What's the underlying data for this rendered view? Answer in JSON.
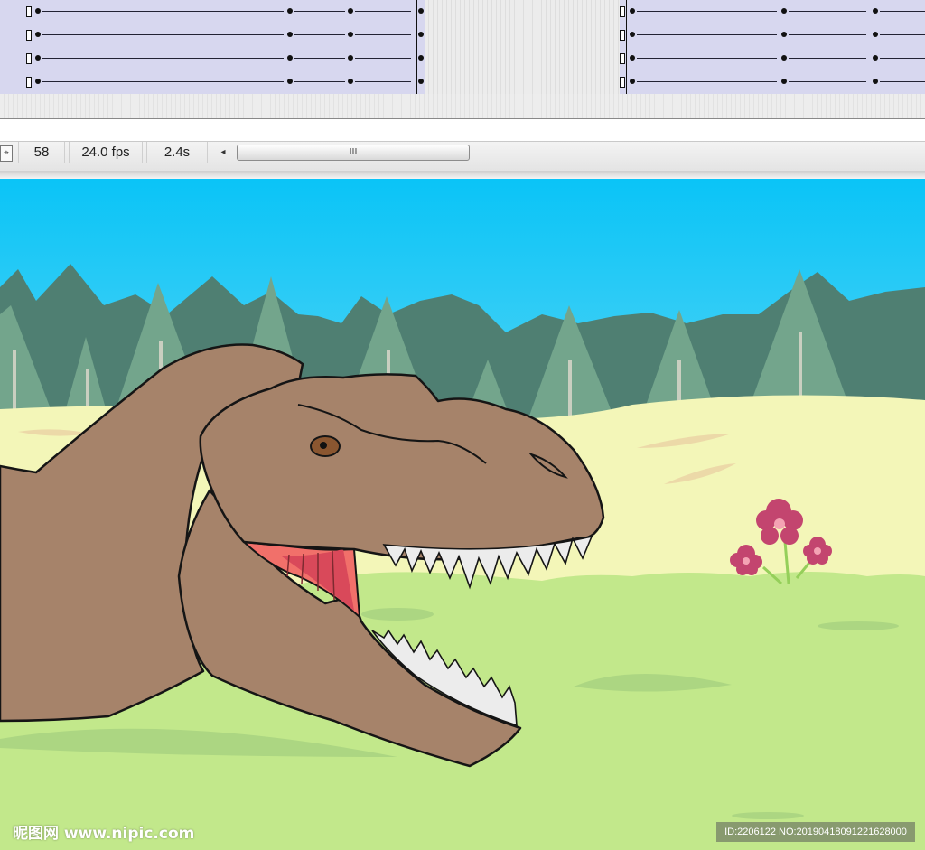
{
  "timeline": {
    "layers": 4,
    "status": {
      "current_frame": "58",
      "frame_rate": "24.0 fps",
      "elapsed_time": "2.4s"
    },
    "scrollbar": {
      "thumb_grip": "III",
      "left_arrow": "◂"
    }
  },
  "stage": {
    "icons": [
      "center-frame-icon",
      "scroll-left-arrow-icon"
    ]
  },
  "watermark": {
    "logo": "昵图网 www.nipic.com",
    "id_text": "ID:2206122 NO:20190418091221628000"
  },
  "colors": {
    "track": "#d7d7ef",
    "playhead": "#d21c1c",
    "sky_top": "#0ac4f7",
    "sky_bottom": "#b7e4ee",
    "meadow": "#f3f6b8",
    "grass": "#c2e88b",
    "dino": "#a6836a",
    "mouth": "#f1706a",
    "flower": "#c3456f"
  }
}
